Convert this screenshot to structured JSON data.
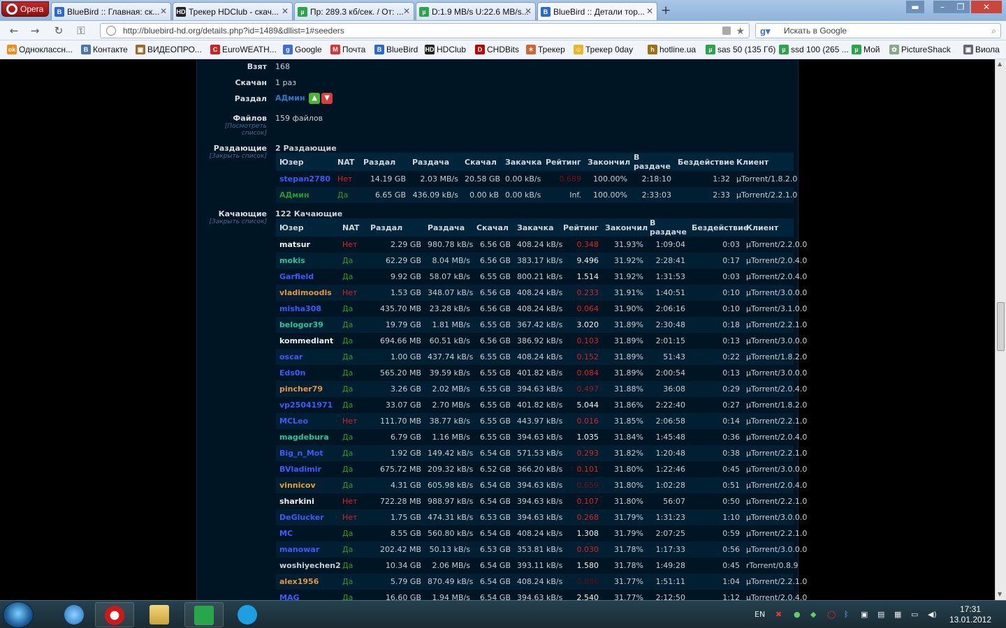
{
  "opera_label": "Opera",
  "tabs": [
    {
      "label": "BlueBird :: Главная: ск...",
      "fav": "B",
      "color": "#2a6ac8"
    },
    {
      "label": "Трекер HDClub - скач...",
      "fav": "HD",
      "color": "#222"
    },
    {
      "label": "Пр: 289.3 кб/сек. / От: ...",
      "fav": "µ",
      "color": "#2aa64a"
    },
    {
      "label": "D:1.9 MB/s U:22.6 MB/s...",
      "fav": "µ",
      "color": "#2aa64a"
    },
    {
      "label": "BlueBird :: Детали тор...",
      "fav": "B",
      "color": "#2a6ac8"
    }
  ],
  "new_tab": "+",
  "url": "http://bluebird-hd.org/details.php?id=1489&dllist=1#seeders",
  "search_placeholder": "Искать в Google",
  "bookmarks": [
    {
      "label": "Одноклассн...",
      "color": "#f28b1a",
      "icon": "ok"
    },
    {
      "label": "Контакте",
      "color": "#4a76a8",
      "icon": "В"
    },
    {
      "label": "ВИДЕОПРО...",
      "color": "#9a6a2a",
      "icon": "▣"
    },
    {
      "label": "EuroWEATH...",
      "color": "#cc2222",
      "icon": "C"
    },
    {
      "label": "Google",
      "color": "#3a6fd8",
      "icon": "g"
    },
    {
      "label": "Почта",
      "color": "#d33",
      "icon": "M"
    },
    {
      "label": "BlueBird",
      "color": "#2a6ac8",
      "icon": "B"
    },
    {
      "label": "HDClub",
      "color": "#222",
      "icon": "HD"
    },
    {
      "label": "CHDBits",
      "color": "#b00",
      "icon": "D"
    },
    {
      "label": "Трекер",
      "color": "#c63",
      "icon": "✶"
    },
    {
      "label": "Трекер 0day",
      "color": "#e6b82a",
      "icon": "☺"
    },
    {
      "label": "hotline.ua",
      "color": "#a07010",
      "icon": "h"
    },
    {
      "label": "sas 50 (135 Гб)",
      "color": "#2aa64a",
      "icon": "µ"
    },
    {
      "label": "ssd 100 (265 ...",
      "color": "#2aa64a",
      "icon": "µ"
    },
    {
      "label": "Мой",
      "color": "#2aa64a",
      "icon": "µ"
    },
    {
      "label": "PictureShack",
      "color": "#8a8",
      "icon": "✿"
    },
    {
      "label": "Виола",
      "color": "#667",
      "icon": "▣"
    }
  ],
  "details": {
    "taken_label": "Взят",
    "taken_value": "168",
    "downloaded_label": "Скачан",
    "downloaded_value": "1 раз",
    "uploader_label": "Раздал",
    "uploader_value": "АДмин",
    "files_label": "Файлов",
    "files_link": "[Посмотреть список]",
    "files_value": "159 файлов",
    "seeders_label": "Раздающие",
    "seeders_link": "[Закрыть список]",
    "seeders_value": "2 Раздающие",
    "leechers_label": "Качающие",
    "leechers_link": "[Закрыть список]",
    "leechers_value": "122 Качающие"
  },
  "columns": [
    "Юзер",
    "NAT",
    "Раздал",
    "Раздача",
    "Скачал",
    "Закачка",
    "Рейтинг",
    "Закончил",
    "В раздаче",
    "Бездействие",
    "Клиент"
  ],
  "colors": {
    "no": "#e02020",
    "yes": "#2a9a2a",
    "low_rating": "#e02020"
  },
  "seeders": [
    {
      "user": "stepan2780",
      "ucolor": "#3a5cff",
      "nat": "Нет",
      "up": "14.19 GB",
      "ups": "2.03 MB/s",
      "down": "20.58 GB",
      "downs": "0.00 kB/s",
      "rating": "0.689",
      "rcolor": "#7a1010",
      "done": "100.00%",
      "seed": "2:18:10",
      "idle": "1:32",
      "client": "µTorrent/1.8.2.0"
    },
    {
      "user": "АДмин",
      "ucolor": "#2a9a2a",
      "nat": "Да",
      "up": "6.65 GB",
      "ups": "436.09 kB/s",
      "down": "0.00 kB",
      "downs": "0.00 kB/s",
      "rating": "Inf.",
      "rcolor": "#c6ced6",
      "done": "100.00%",
      "seed": "2:33:03",
      "idle": "2:33",
      "client": "µTorrent/2.2.1.0"
    }
  ],
  "leechers": [
    {
      "user": "matsur",
      "ucolor": "#f0f0f0",
      "nat": "Нет",
      "up": "2.29 GB",
      "ups": "980.78 kB/s",
      "down": "6.56 GB",
      "downs": "408.24 kB/s",
      "rating": "0.348",
      "rcolor": "#e02020",
      "done": "31.93%",
      "seed": "1:09:04",
      "idle": "0:03",
      "client": "µTorrent/2.2.0.0"
    },
    {
      "user": "mokis",
      "ucolor": "#20c8a0",
      "nat": "Да",
      "up": "62.29 GB",
      "ups": "8.04 MB/s",
      "down": "6.56 GB",
      "downs": "383.17 kB/s",
      "rating": "9.496",
      "rcolor": "#f0f0f0",
      "done": "31.92%",
      "seed": "2:28:41",
      "idle": "0:17",
      "client": "µTorrent/2.0.4.0"
    },
    {
      "user": "Garfield",
      "ucolor": "#3a5cff",
      "nat": "Да",
      "up": "9.92 GB",
      "ups": "58.07 kB/s",
      "down": "6.55 GB",
      "downs": "800.21 kB/s",
      "rating": "1.514",
      "rcolor": "#f0f0f0",
      "done": "31.92%",
      "seed": "1:31:53",
      "idle": "0:03",
      "client": "µTorrent/2.0.4.0"
    },
    {
      "user": "vladimoodis",
      "ucolor": "#e8943a",
      "nat": "Нет",
      "up": "1.53 GB",
      "ups": "348.07 kB/s",
      "down": "6.56 GB",
      "downs": "408.24 kB/s",
      "rating": "0.233",
      "rcolor": "#e02020",
      "done": "31.91%",
      "seed": "1:40:51",
      "idle": "0:10",
      "client": "µTorrent/3.0.0.0"
    },
    {
      "user": "misha308",
      "ucolor": "#3a5cff",
      "nat": "Да",
      "up": "435.70 MB",
      "ups": "23.28 kB/s",
      "down": "6.56 GB",
      "downs": "408.24 kB/s",
      "rating": "0.064",
      "rcolor": "#e02020",
      "done": "31.90%",
      "seed": "2:06:16",
      "idle": "0:10",
      "client": "µTorrent/3.1.0.0"
    },
    {
      "user": "belogor39",
      "ucolor": "#20c8a0",
      "nat": "Да",
      "up": "19.79 GB",
      "ups": "1.81 MB/s",
      "down": "6.55 GB",
      "downs": "367.42 kB/s",
      "rating": "3.020",
      "rcolor": "#f0f0f0",
      "done": "31.89%",
      "seed": "2:30:48",
      "idle": "0:18",
      "client": "µTorrent/2.2.1.0"
    },
    {
      "user": "kommediant",
      "ucolor": "#f0f0f0",
      "nat": "Да",
      "up": "694.66 MB",
      "ups": "60.51 kB/s",
      "down": "6.56 GB",
      "downs": "386.92 kB/s",
      "rating": "0.103",
      "rcolor": "#e02020",
      "done": "31.89%",
      "seed": "2:01:15",
      "idle": "0:13",
      "client": "µTorrent/3.0.0.0"
    },
    {
      "user": "oscar",
      "ucolor": "#3a5cff",
      "nat": "Да",
      "up": "1.00 GB",
      "ups": "437.74 kB/s",
      "down": "6.55 GB",
      "downs": "408.24 kB/s",
      "rating": "0.152",
      "rcolor": "#e02020",
      "done": "31.89%",
      "seed": "51:43",
      "idle": "0:22",
      "client": "µTorrent/1.8.2.0"
    },
    {
      "user": "Eds0n",
      "ucolor": "#3a5cff",
      "nat": "Да",
      "up": "565.20 MB",
      "ups": "39.59 kB/s",
      "down": "6.55 GB",
      "downs": "401.82 kB/s",
      "rating": "0.084",
      "rcolor": "#e02020",
      "done": "31.89%",
      "seed": "2:00:54",
      "idle": "0:13",
      "client": "µTorrent/3.0.0.0"
    },
    {
      "user": "pincher79",
      "ucolor": "#e8943a",
      "nat": "Да",
      "up": "3.26 GB",
      "ups": "2.02 MB/s",
      "down": "6.55 GB",
      "downs": "394.63 kB/s",
      "rating": "0.497",
      "rcolor": "#a01818",
      "done": "31.88%",
      "seed": "36:08",
      "idle": "0:29",
      "client": "µTorrent/2.0.4.0"
    },
    {
      "user": "vp25041971",
      "ucolor": "#3a5cff",
      "nat": "Да",
      "up": "33.07 GB",
      "ups": "2.70 MB/s",
      "down": "6.55 GB",
      "downs": "401.82 kB/s",
      "rating": "5.044",
      "rcolor": "#f0f0f0",
      "done": "31.86%",
      "seed": "2:22:40",
      "idle": "0:27",
      "client": "µTorrent/1.8.2.0"
    },
    {
      "user": "MCLeo",
      "ucolor": "#3a5cff",
      "nat": "Нет",
      "up": "111.70 MB",
      "ups": "38.77 kB/s",
      "down": "6.55 GB",
      "downs": "443.97 kB/s",
      "rating": "0.016",
      "rcolor": "#e02020",
      "done": "31.85%",
      "seed": "2:06:58",
      "idle": "0:14",
      "client": "µTorrent/2.2.1.0"
    },
    {
      "user": "magdebura",
      "ucolor": "#20c8a0",
      "nat": "Да",
      "up": "6.79 GB",
      "ups": "1.16 MB/s",
      "down": "6.55 GB",
      "downs": "394.63 kB/s",
      "rating": "1.035",
      "rcolor": "#f0f0f0",
      "done": "31.84%",
      "seed": "1:45:48",
      "idle": "0:36",
      "client": "µTorrent/2.0.4.0"
    },
    {
      "user": "Big_n_Mot",
      "ucolor": "#3a5cff",
      "nat": "Да",
      "up": "1.92 GB",
      "ups": "149.42 kB/s",
      "down": "6.54 GB",
      "downs": "571.53 kB/s",
      "rating": "0.293",
      "rcolor": "#e02020",
      "done": "31.82%",
      "seed": "1:20:48",
      "idle": "0:38",
      "client": "µTorrent/2.2.1.0"
    },
    {
      "user": "BVladimir",
      "ucolor": "#3a5cff",
      "nat": "Да",
      "up": "675.72 MB",
      "ups": "209.32 kB/s",
      "down": "6.52 GB",
      "downs": "366.20 kB/s",
      "rating": "0.101",
      "rcolor": "#e02020",
      "done": "31.80%",
      "seed": "1:22:46",
      "idle": "0:45",
      "client": "µTorrent/3.0.0.0"
    },
    {
      "user": "vinnicov",
      "ucolor": "#e8a020",
      "nat": "Да",
      "up": "4.31 GB",
      "ups": "605.98 kB/s",
      "down": "6.54 GB",
      "downs": "394.63 kB/s",
      "rating": "0.659",
      "rcolor": "#7a1010",
      "done": "31.80%",
      "seed": "1:02:28",
      "idle": "0:51",
      "client": "µTorrent/2.0.4.0"
    },
    {
      "user": "sharkini",
      "ucolor": "#f0f0f0",
      "nat": "Нет",
      "up": "722.28 MB",
      "ups": "988.97 kB/s",
      "down": "6.54 GB",
      "downs": "394.63 kB/s",
      "rating": "0.107",
      "rcolor": "#e02020",
      "done": "31.80%",
      "seed": "56:07",
      "idle": "0:50",
      "client": "µTorrent/2.2.1.0"
    },
    {
      "user": "DeGlucker",
      "ucolor": "#3a5cff",
      "nat": "Нет",
      "up": "1.75 GB",
      "ups": "474.31 kB/s",
      "down": "6.53 GB",
      "downs": "394.63 kB/s",
      "rating": "0.268",
      "rcolor": "#e02020",
      "done": "31.79%",
      "seed": "1:31:23",
      "idle": "1:10",
      "client": "µTorrent/3.0.0.0"
    },
    {
      "user": "MC",
      "ucolor": "#3a5cff",
      "nat": "Да",
      "up": "8.55 GB",
      "ups": "560.80 kB/s",
      "down": "6.54 GB",
      "downs": "408.24 kB/s",
      "rating": "1.308",
      "rcolor": "#f0f0f0",
      "done": "31.79%",
      "seed": "2:07:25",
      "idle": "0:59",
      "client": "µTorrent/2.2.1.0"
    },
    {
      "user": "manowar",
      "ucolor": "#3a5cff",
      "nat": "Да",
      "up": "202.42 MB",
      "ups": "50.13 kB/s",
      "down": "6.53 GB",
      "downs": "353.81 kB/s",
      "rating": "0.030",
      "rcolor": "#e02020",
      "done": "31.78%",
      "seed": "1:17:33",
      "idle": "0:56",
      "client": "µTorrent/3.0.0.0"
    },
    {
      "user": "woshiyechen2",
      "ucolor": "#c6ced6",
      "nat": "Да",
      "up": "10.34 GB",
      "ups": "2.06 MB/s",
      "down": "6.54 GB",
      "downs": "393.11 kB/s",
      "rating": "1.580",
      "rcolor": "#f0f0f0",
      "done": "31.78%",
      "seed": "1:49:28",
      "idle": "0:45",
      "client": "rTorrent/0.8.9"
    },
    {
      "user": "alex1956",
      "ucolor": "#e8943a",
      "nat": "Да",
      "up": "5.79 GB",
      "ups": "870.49 kB/s",
      "down": "6.54 GB",
      "downs": "408.24 kB/s",
      "rating": "0.886",
      "rcolor": "#5a1010",
      "done": "31.77%",
      "seed": "1:51:11",
      "idle": "1:04",
      "client": "µTorrent/2.2.1.0"
    },
    {
      "user": "MAG",
      "ucolor": "#3a5cff",
      "nat": "Да",
      "up": "16.60 GB",
      "ups": "1.94 MB/s",
      "down": "6.54 GB",
      "downs": "394.63 kB/s",
      "rating": "2.540",
      "rcolor": "#f0f0f0",
      "done": "31.77%",
      "seed": "2:12:50",
      "idle": "1:12",
      "client": "µTorrent/2.0.4.0"
    }
  ],
  "taskbar": {
    "lang": "EN",
    "time": "17:31",
    "date": "13.01.2012"
  }
}
